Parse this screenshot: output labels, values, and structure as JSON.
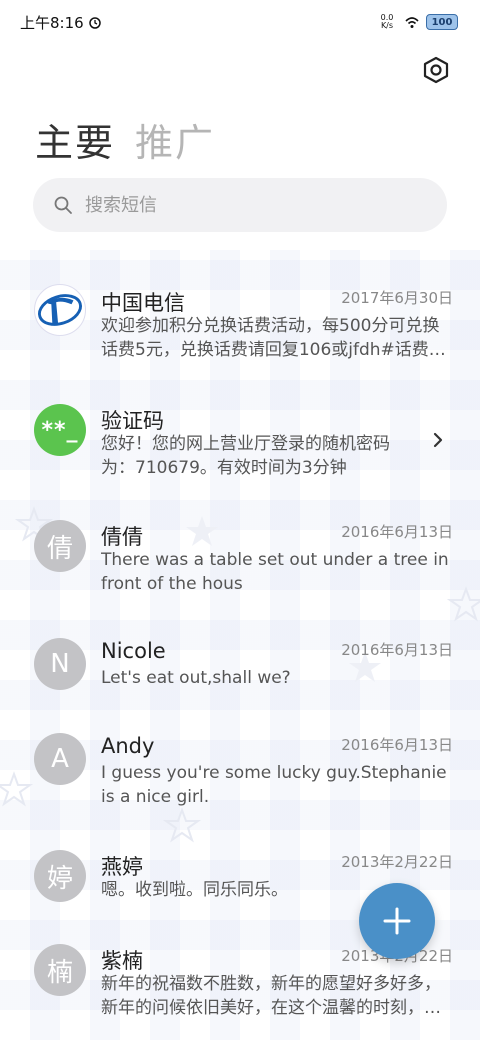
{
  "status_bar": {
    "time": "上午8:16",
    "network_speed": "0.0 K/s",
    "battery": "100"
  },
  "tabs": {
    "primary": "主要",
    "promo": "推广"
  },
  "search": {
    "placeholder": "搜索短信"
  },
  "conversations": [
    {
      "name": "中国电信",
      "date": "2017年6月30日",
      "preview": "欢迎参加积分兑换话费活动，每500分可兑换话费5元，兑换话费请回复106或jfdh#话费金额",
      "avatar": "",
      "avatar_type": "telecom"
    },
    {
      "name": "验证码",
      "date": "",
      "preview": "您好！您的网上营业厅登录的随机密码为：710679。有效时间为3分钟",
      "avatar": "**_",
      "avatar_type": "code"
    },
    {
      "name": "倩倩",
      "date": "2016年6月13日",
      "preview": "There was a table set out under a tree in front of the hous",
      "avatar": "倩",
      "avatar_type": "letter"
    },
    {
      "name": "Nicole",
      "date": "2016年6月13日",
      "preview": "Let's eat out,shall we?",
      "avatar": "N",
      "avatar_type": "letter"
    },
    {
      "name": "Andy",
      "date": "2016年6月13日",
      "preview": "I guess you're some lucky guy.Stephanie is a nice girl.",
      "avatar": "A",
      "avatar_type": "letter"
    },
    {
      "name": "燕婷",
      "date": "2013年2月22日",
      "preview": "嗯。收到啦。同乐同乐。",
      "avatar": "婷",
      "avatar_type": "letter"
    },
    {
      "name": "紫楠",
      "date": "2013年2月22日",
      "preview": "新年的祝福数不胜数，新年的愿望好多好多，新年的问候依旧美好，在这个温馨的时刻，送上我的祝福",
      "avatar": "楠",
      "avatar_type": "letter"
    }
  ],
  "colors": {
    "fab": "#4a90c8",
    "code_avatar": "#5bc44e",
    "letter_avatar": "#c3c3c6"
  },
  "icons": {
    "settings": "hexagon-settings-icon",
    "search": "search-icon",
    "fab": "plus-icon",
    "chevron": "chevron-right-icon"
  }
}
